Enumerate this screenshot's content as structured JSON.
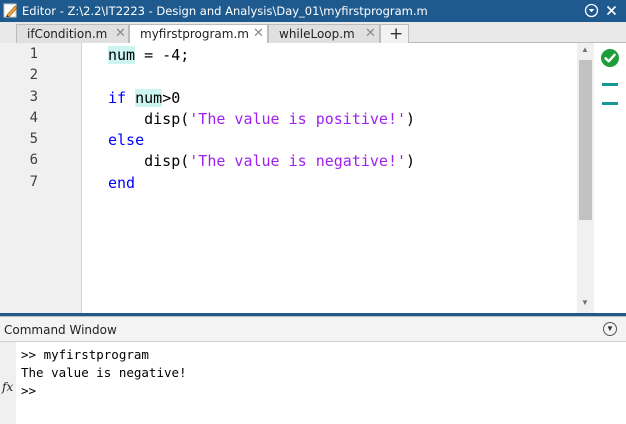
{
  "title_bar": {
    "title": "Editor - Z:\\2.2\\IT2223 - Design and Analysis\\Day_01\\myfirstprogram.m",
    "icons": {
      "app": "editor-pencil-icon",
      "menu": "down-circle-icon",
      "close": "close-icon"
    },
    "background": "#1e5a8e"
  },
  "tabs": [
    {
      "label": "ifCondition.m",
      "active": false
    },
    {
      "label": "myfirstprogram.m",
      "active": true
    },
    {
      "label": "whileLoop.m",
      "active": false
    }
  ],
  "add_tab_label": "+",
  "editor": {
    "line_numbers": [
      "1",
      "2",
      "3",
      "4",
      "5",
      "6",
      "7"
    ],
    "lines": [
      {
        "t1": "num",
        "t2": " = -4;"
      },
      {
        "t1": ""
      },
      {
        "k": "if",
        "sp": " ",
        "hl": "num",
        "rest": ">0"
      },
      {
        "pre": "    disp(",
        "s": "'The value is positive!'",
        "post": ")"
      },
      {
        "k": "else"
      },
      {
        "pre": "    disp(",
        "s": "'The value is negative!'",
        "post": ")"
      },
      {
        "k": "end"
      }
    ],
    "colors": {
      "keyword": "#0000ff",
      "string": "#a020f0",
      "highlight": "#ccf5f2"
    },
    "code_analyzer_status": "no-warnings-check-icon"
  },
  "command_window": {
    "title": "Command Window",
    "lines": [
      ">> myfirstprogram",
      "The value is negative!",
      ">>"
    ],
    "prompt_icon": "fx-icon"
  }
}
